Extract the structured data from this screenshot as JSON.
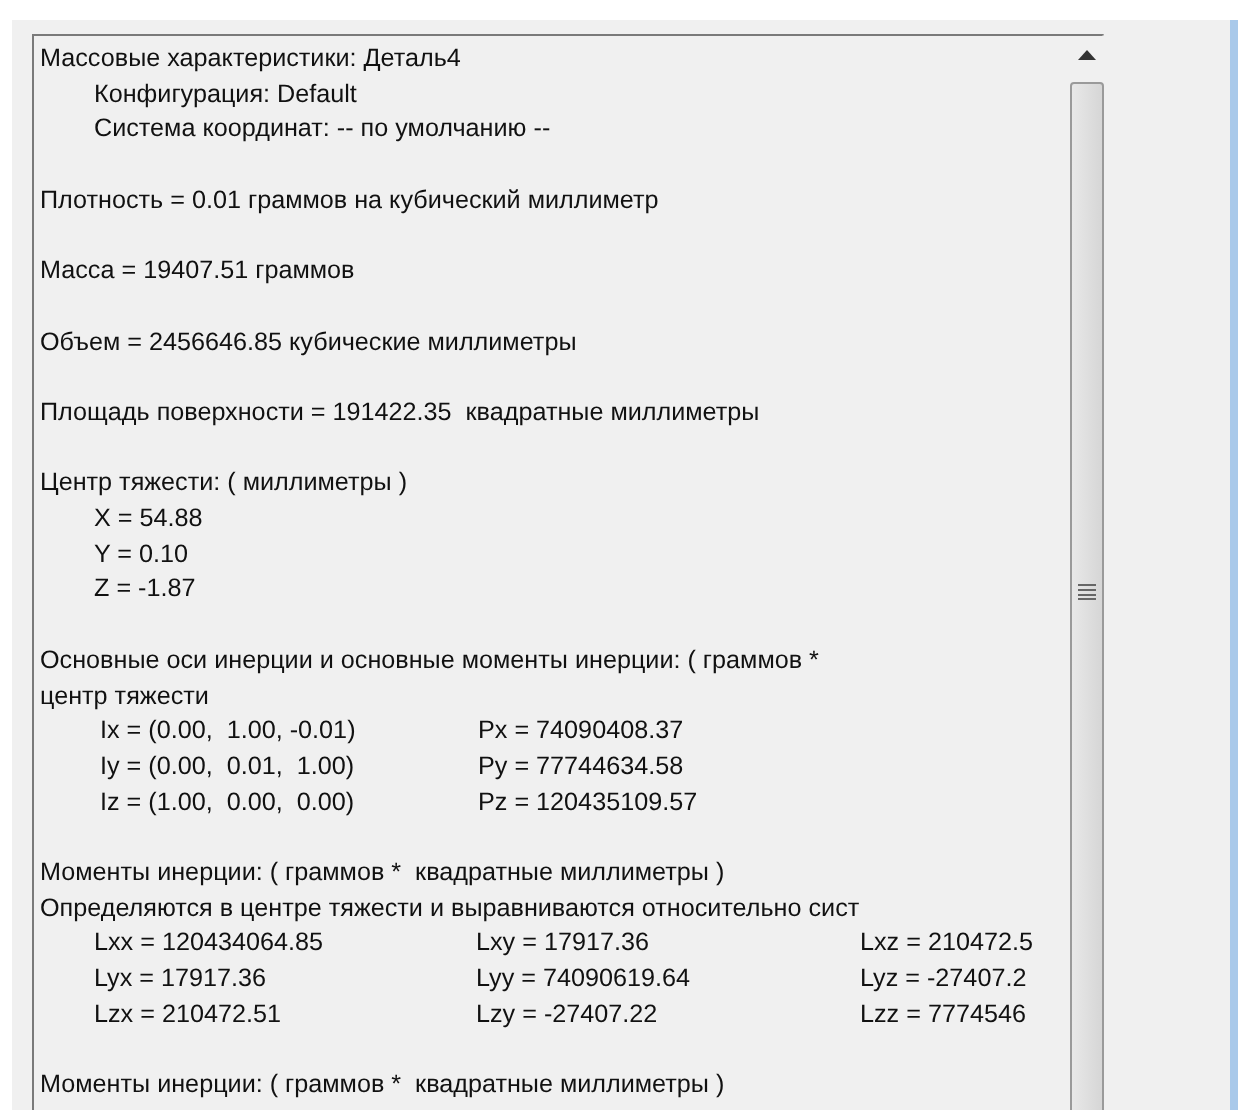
{
  "sections": [
    {
      "lines": [
        "Массовые характеристики: Деталь4"
      ],
      "children": [
        {
          "text": "Конфигурация: Default"
        },
        {
          "text": "Система координат: -- по умолчанию --"
        }
      ]
    },
    {
      "lines": [
        "Плотность = 0.01 граммов на кубический миллиметр"
      ]
    },
    {
      "lines": [
        "Масса = 19407.51 граммов"
      ]
    },
    {
      "lines": [
        "Объем = 2456646.85 кубические миллиметры"
      ]
    },
    {
      "lines": [
        "Площадь поверхности = 191422.35  квадратные миллиметры"
      ]
    },
    {
      "lines": [
        "Центр тяжести: ( миллиметры )"
      ],
      "children": [
        {
          "text": "X = 54.88"
        },
        {
          "text": "Y = 0.10"
        },
        {
          "text": "Z = -1.87"
        }
      ]
    },
    {
      "lines": [
        "Основные оси инерции и основные моменты инерции: ( граммов *",
        "центр тяжести"
      ],
      "rows": [
        [
          "Ix = (0.00,  1.00, -0.01)",
          "Px = 74090408.37"
        ],
        [
          "Iy = (0.00,  0.01,  1.00)",
          "Py = 77744634.58"
        ],
        [
          "Iz = (1.00,  0.00,  0.00)",
          "Pz = 120435109.57"
        ]
      ]
    },
    {
      "lines": [
        "Моменты инерции: ( граммов *  квадратные миллиметры )",
        "Определяются в центре тяжести и выравниваются относительно сист"
      ],
      "rows": [
        [
          "Lxx = 120434064.85",
          "Lxy = 17917.36",
          "Lxz = 210472.5"
        ],
        [
          "Lyx = 17917.36",
          "Lyy = 74090619.64",
          "Lyz = -27407.2"
        ],
        [
          "Lzx = 210472.51",
          "Lzy = -27407.22",
          "Lzz = 7774546"
        ]
      ]
    },
    {
      "lines": [
        "Моменты инерции: ( граммов *  квадратные миллиметры )"
      ]
    }
  ]
}
